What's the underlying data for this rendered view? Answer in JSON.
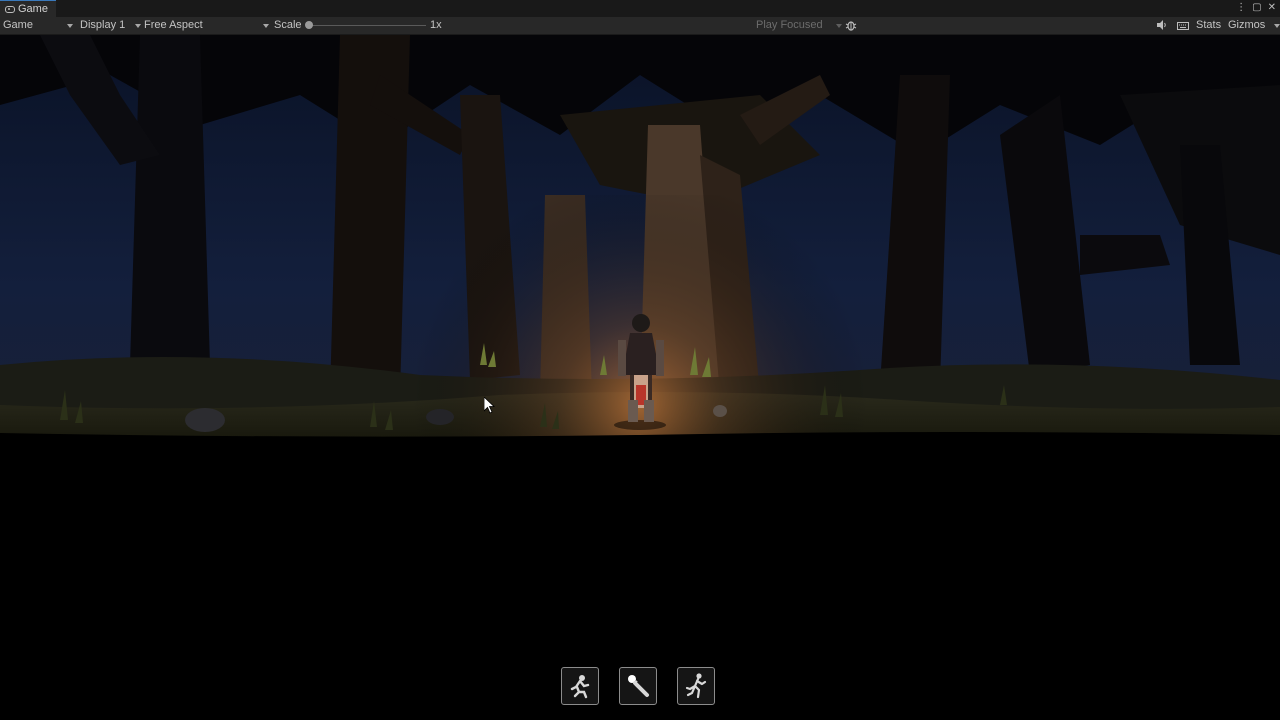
{
  "tab": {
    "title": "Game",
    "icon": "gamepad-icon"
  },
  "window_controls": {
    "menu": "⋮",
    "maximize": "▢",
    "close": "✕"
  },
  "toolbar": {
    "view_mode": "Game",
    "display": "Display 1",
    "aspect": "Free Aspect",
    "scale_label": "Scale",
    "scale_value": "1x",
    "play_mode": "Play Focused",
    "stats_label": "Stats",
    "gizmos_label": "Gizmos"
  },
  "action_buttons": [
    {
      "name": "crouch-button",
      "icon": "crouch-icon"
    },
    {
      "name": "attack-button",
      "icon": "torch-icon"
    },
    {
      "name": "run-button",
      "icon": "run-icon"
    }
  ],
  "colors": {
    "accent": "#3a79bb",
    "editor_bg": "#282828",
    "sky": "#0f1a33",
    "torch_glow": "#d07a3a"
  }
}
